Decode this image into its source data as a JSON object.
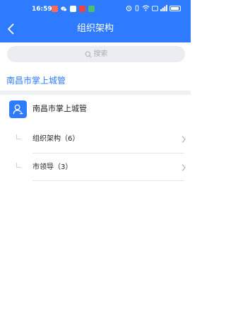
{
  "status_bar": {
    "time": "16:59",
    "battery_icon": "battery-icon"
  },
  "nav": {
    "title": "组织架构",
    "back_icon": "chevron-left-icon"
  },
  "search": {
    "placeholder": "搜索",
    "icon": "search-icon"
  },
  "breadcrumb": {
    "label": "南昌市掌上城管"
  },
  "org": {
    "name": "南昌市掌上城管",
    "icon": "person-icon"
  },
  "items": [
    {
      "label": "组织架构（6）"
    },
    {
      "label": "市领导（3）"
    }
  ],
  "colors": {
    "primary": "#2f7bff",
    "background": "#ffffff",
    "divider": "#f0f1f3",
    "search_bg": "#ebedf0"
  }
}
